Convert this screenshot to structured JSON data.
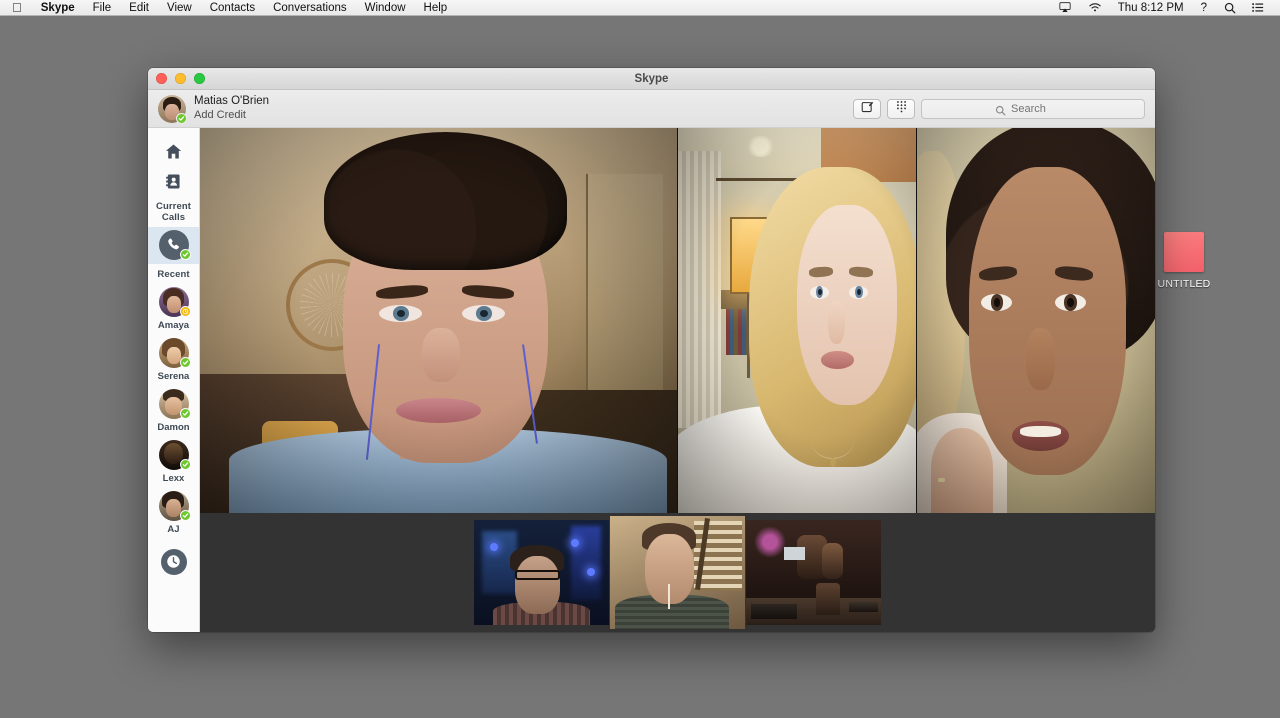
{
  "menubar": {
    "apple": "apple-logo",
    "items": [
      {
        "label": "Skype",
        "bold": true
      },
      {
        "label": "File",
        "bold": false
      },
      {
        "label": "Edit",
        "bold": false
      },
      {
        "label": "View",
        "bold": false
      },
      {
        "label": "Contacts",
        "bold": false
      },
      {
        "label": "Conversations",
        "bold": false
      },
      {
        "label": "Window",
        "bold": false
      },
      {
        "label": "Help",
        "bold": false
      }
    ],
    "status": {
      "airplay_icon": "airplay-icon",
      "wifi_icon": "wifi-icon",
      "clock": "Thu 8:12 PM",
      "help": "?",
      "search_icon": "spotlight-search-icon",
      "list_icon": "notification-center-icon"
    }
  },
  "desktop": {
    "background_color": "#767676",
    "icon": {
      "label": "UNTITLED",
      "color": "#f4606a"
    }
  },
  "window": {
    "title": "Skype",
    "traffic_lights": [
      "close",
      "minimize",
      "zoom"
    ]
  },
  "toolbar": {
    "account_name": "Matias O'Brien",
    "account_action": "Add Credit",
    "account_status": "online",
    "compose_icon": "compose-icon",
    "dialpad_icon": "dialpad-icon",
    "search": {
      "placeholder": "Search",
      "value": "",
      "icon": "search-icon"
    }
  },
  "sidebar": {
    "nav": [
      {
        "name": "home-icon",
        "label": "Home"
      },
      {
        "name": "contacts-icon",
        "label": "Contacts"
      }
    ],
    "sections": [
      {
        "label": "Current Calls",
        "items": [
          {
            "name": "Group Call",
            "status": "online",
            "active": true,
            "icon": "phone-icon",
            "show_name": false
          }
        ]
      },
      {
        "label": "Recent",
        "items": [
          {
            "name": "Amaya",
            "status": "away",
            "active": false,
            "avatar": "av-amaya",
            "show_name": true
          },
          {
            "name": "Serena",
            "status": "online",
            "active": false,
            "avatar": "av-serena",
            "show_name": true
          },
          {
            "name": "Damon",
            "status": "online",
            "active": false,
            "avatar": "av-damon",
            "show_name": true
          },
          {
            "name": "Lexx",
            "status": "online",
            "active": false,
            "avatar": "av-lexx",
            "show_name": true
          },
          {
            "name": "AJ",
            "status": "online",
            "active": false,
            "avatar": "av-aj",
            "show_name": true
          }
        ]
      }
    ],
    "history_icon": "history-clock-icon"
  },
  "call": {
    "video_tiles": [
      {
        "participant": "main-speaker",
        "scene": "sc-main",
        "size": "main"
      },
      {
        "participant": "participant-2",
        "scene": "sc-a",
        "size": "side"
      },
      {
        "participant": "participant-3",
        "scene": "sc-b",
        "size": "side"
      }
    ],
    "filmstrip": [
      {
        "participant": "thumb-1",
        "scene": "sc-t1"
      },
      {
        "participant": "thumb-2",
        "scene": "sc-t2"
      },
      {
        "participant": "thumb-3",
        "scene": "sc-t3"
      }
    ],
    "stage_background": "#333333"
  }
}
